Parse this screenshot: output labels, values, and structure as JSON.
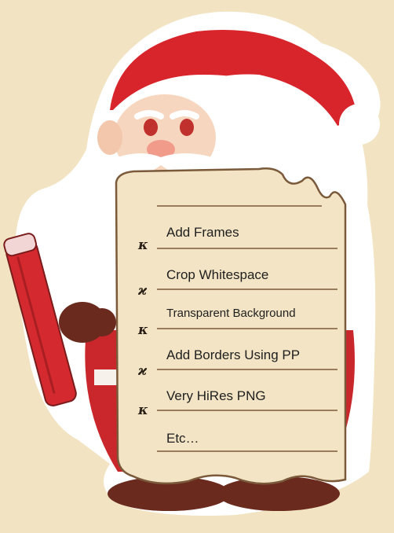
{
  "checklist": {
    "items": [
      {
        "label": "Add  Frames",
        "mark": "κ"
      },
      {
        "label": "Crop Whitespace",
        "mark": "ϰ"
      },
      {
        "label": "Transparent Background",
        "mark": "κ"
      },
      {
        "label": "Add Borders Using PP",
        "mark": "ϰ"
      },
      {
        "label": "Very HiRes PNG",
        "mark": "κ"
      },
      {
        "label": "Etc…",
        "mark": ""
      }
    ]
  },
  "colors": {
    "background": "#f5e6c8",
    "hat_red": "#d8252b",
    "fur_white": "#ffffff",
    "paper": "#f2e4c4",
    "paper_outline": "#7a5a3a",
    "pencil_red": "#d42a2f",
    "coat_red": "#c9272c",
    "boot_brown": "#6b2a1e"
  }
}
